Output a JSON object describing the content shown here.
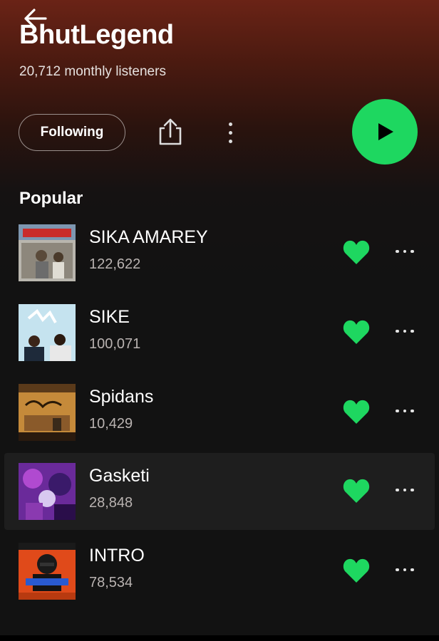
{
  "artist": {
    "name": "BhutLegend",
    "listeners": "20,712 monthly listeners"
  },
  "actions": {
    "follow_label": "Following"
  },
  "colors": {
    "accent": "#1ed760",
    "background": "#121212",
    "header_tint": "#6a2316"
  },
  "popular": {
    "title": "Popular",
    "tracks": [
      {
        "title": "SIKA AMAREY",
        "plays": "122,622",
        "liked": true
      },
      {
        "title": "SIKE",
        "plays": "100,071",
        "liked": true
      },
      {
        "title": "Spidans",
        "plays": "10,429",
        "liked": true
      },
      {
        "title": "Gasketi",
        "plays": "28,848",
        "liked": true
      },
      {
        "title": "INTRO",
        "plays": "78,534",
        "liked": true
      }
    ]
  },
  "icons": {
    "back": "arrow-left-icon",
    "share": "share-icon",
    "more": "more-vertical-icon",
    "play": "play-icon",
    "heart": "heart-icon",
    "track_more": "more-horizontal-icon"
  }
}
